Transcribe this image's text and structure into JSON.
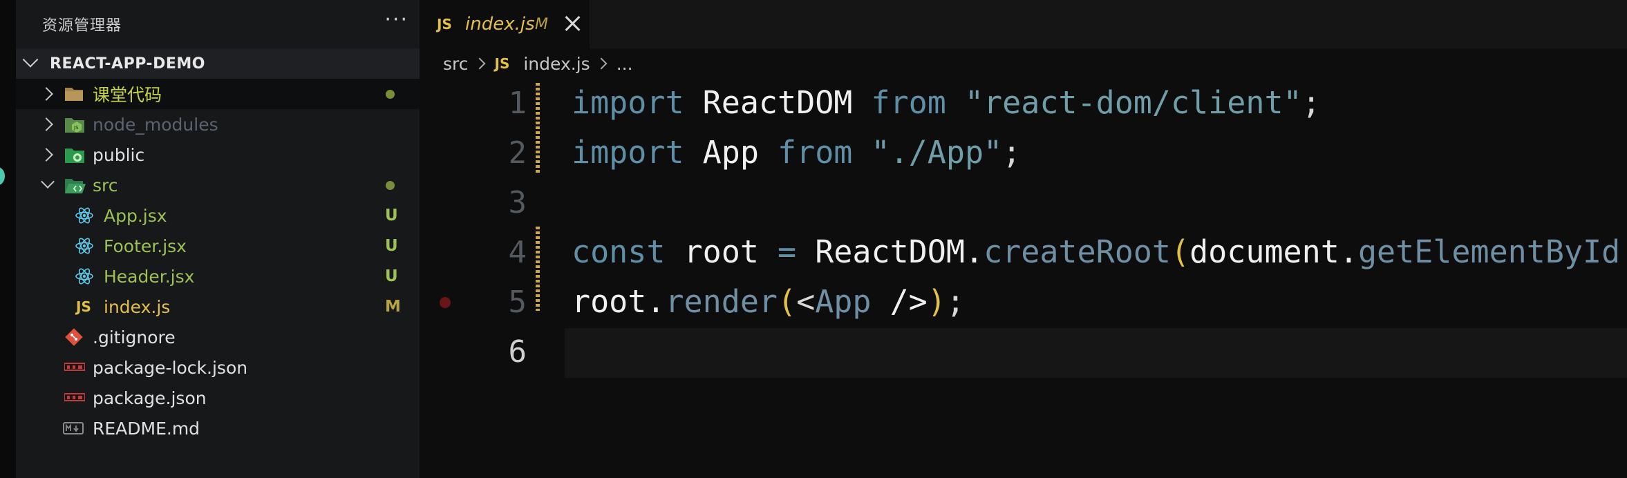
{
  "sidebar": {
    "title": "资源管理器",
    "more_label": "···",
    "project": "REACT-APP-DEMO",
    "items": [
      {
        "label": "课堂代码",
        "color": "#c6d448",
        "status": ""
      },
      {
        "label": "node_modules",
        "color": "#5c6370",
        "status": ""
      },
      {
        "label": "public",
        "color": "#e0e0e0",
        "status": ""
      },
      {
        "label": "src",
        "color": "#9cc256",
        "status": ""
      },
      {
        "label": "App.jsx",
        "color": "#9cc256",
        "status": "U"
      },
      {
        "label": "Footer.jsx",
        "color": "#9cc256",
        "status": "U"
      },
      {
        "label": "Header.jsx",
        "color": "#9cc256",
        "status": "U"
      },
      {
        "label": "index.js",
        "color": "#e2c04a",
        "status": "M",
        "icon_text": "JS"
      },
      {
        "label": ".gitignore",
        "color": "#e0e0e0",
        "status": ""
      },
      {
        "label": "package-lock.json",
        "color": "#e0e0e0",
        "status": ""
      },
      {
        "label": "package.json",
        "color": "#e0e0e0",
        "status": ""
      },
      {
        "label": "README.md",
        "color": "#e0e0e0",
        "status": ""
      }
    ]
  },
  "editor": {
    "tab": {
      "icon_text": "JS",
      "name": "index.js",
      "modified": "M"
    },
    "breadcrumb": {
      "folder": "src",
      "icon_text": "JS",
      "file": "index.js",
      "more": "..."
    },
    "line_numbers": [
      "1",
      "2",
      "3",
      "4",
      "5",
      "6"
    ],
    "code": {
      "l1": [
        "import",
        " ReactDOM ",
        "from",
        " \"react-dom/client\"",
        ";"
      ],
      "l2": [
        "import",
        " App ",
        "from",
        " \"./App\"",
        ";"
      ],
      "l4": [
        "const",
        " root ",
        "=",
        " ReactDOM.",
        "createRoot",
        "(",
        "document.",
        "getElementById"
      ],
      "l5": [
        "root.",
        "render",
        "(",
        "<",
        "App",
        " />",
        ")",
        ";"
      ]
    }
  },
  "colors": {
    "accent_yellow": "#e2c04a",
    "git_untracked_green": "#9cc256",
    "keyword_blue": "#5f8fa7",
    "sidebar_bg": "#17181a",
    "editor_bg": "#0d0d0d"
  }
}
